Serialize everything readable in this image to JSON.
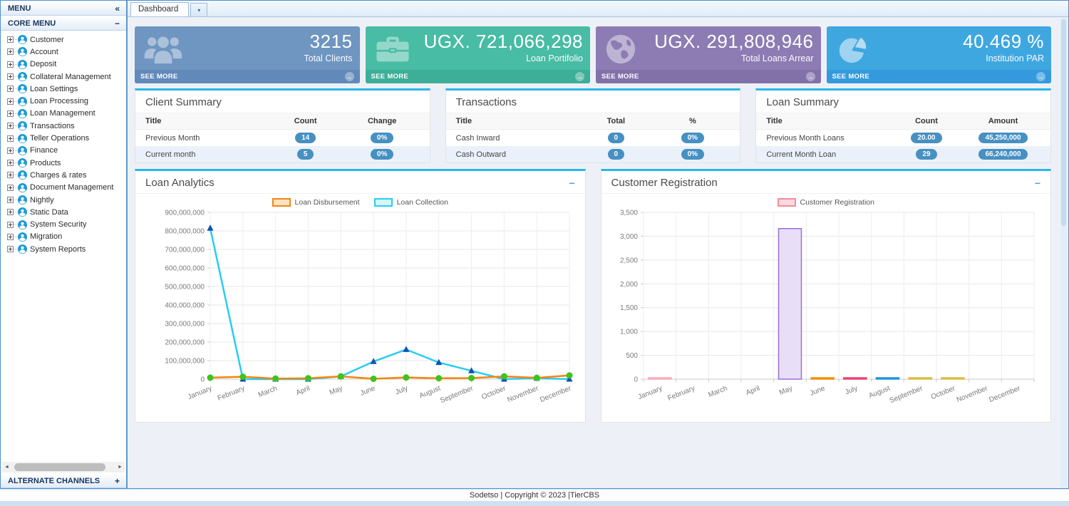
{
  "window": {
    "footer": "Sodetso | Copyright © 2023 |TierCBS"
  },
  "sidebar": {
    "menu_header": "MENU",
    "collapse_icon": "«",
    "core_menu": {
      "label": "CORE MENU",
      "state_icon": "−"
    },
    "items": [
      "Customer",
      "Account",
      "Deposit",
      "Collateral Management",
      "Loan Settings",
      "Loan Processing",
      "Loan Management",
      "Transactions",
      "Teller Operations",
      "Finance",
      "Products",
      "Charges & rates",
      "Document Management",
      "Nightly",
      "Static Data",
      "System Security",
      "Migration",
      "System Reports"
    ],
    "alternate": {
      "label": "ALTERNATE CHANNELS",
      "state_icon": "+"
    }
  },
  "tabbar": {
    "active_tab": "Dashboard"
  },
  "stat_cards": [
    {
      "name": "total-clients-card",
      "icon": "users-icon",
      "value": "3215",
      "label": "Total Clients",
      "see_more": "SEE MORE",
      "color": "#6f95c1",
      "strip_color": "#6189ba"
    },
    {
      "name": "loan-portfolio-card",
      "icon": "briefcase-icon",
      "value": "UGX. 721,066,298",
      "label": "Loan Portifolio",
      "see_more": "SEE MORE",
      "color": "#48bca4",
      "strip_color": "#3dae97"
    },
    {
      "name": "total-loans-arrear-card",
      "icon": "globe-icon",
      "value": "UGX. 291,808,946",
      "label": "Total Loans Arrear",
      "see_more": "SEE MORE",
      "color": "#8d7cb3",
      "strip_color": "#8271a9"
    },
    {
      "name": "institution-par-card",
      "icon": "pie-icon",
      "value": "40.469 %",
      "label": "Institution PAR",
      "see_more": "SEE MORE",
      "color": "#3fa7e0",
      "strip_color": "#359add"
    }
  ],
  "summary_panels": [
    {
      "name": "client-summary-panel",
      "title": "Client Summary",
      "columns": [
        "Title",
        "Count",
        "Change"
      ],
      "rows": [
        [
          "Previous Month",
          "14",
          "0%"
        ],
        [
          "Current month",
          "5",
          "0%"
        ]
      ]
    },
    {
      "name": "transactions-panel",
      "title": "Transactions",
      "columns": [
        "Title",
        "Total",
        "%"
      ],
      "rows": [
        [
          "Cash Inward",
          "0",
          "0%"
        ],
        [
          "Cash Outward",
          "0",
          "0%"
        ]
      ]
    },
    {
      "name": "loan-summary-panel",
      "title": "Loan Summary",
      "columns": [
        "Title",
        "Count",
        "Amount"
      ],
      "rows": [
        [
          "Previous Month Loans",
          "20.00",
          "45,250,000"
        ],
        [
          "Current Month Loan",
          "29",
          "66,240,000"
        ]
      ]
    }
  ],
  "accent_colors": {
    "panel_top_border": "#29b7e9",
    "badge": "#4690c2"
  },
  "chart_data": [
    {
      "type": "line",
      "title": "Loan Analytics",
      "categories": [
        "January",
        "February",
        "March",
        "April",
        "May",
        "June",
        "July",
        "August",
        "September",
        "October",
        "November",
        "December"
      ],
      "series": [
        {
          "name": "Loan Disbursement",
          "line_color": "#f58511",
          "legend_fill": "#fbe3c4",
          "marker": "circle",
          "marker_color": "#3fc31d",
          "values": [
            8000000,
            13000000,
            3000000,
            5000000,
            15000000,
            2000000,
            9000000,
            5000000,
            6000000,
            15000000,
            7000000,
            20000000
          ]
        },
        {
          "name": "Loan Collection",
          "line_color": "#27cdf2",
          "legend_fill": "#d6f6fd",
          "marker": "triangle",
          "marker_color": "#1350b0",
          "values": [
            815000000,
            0,
            0,
            0,
            15000000,
            95000000,
            160000000,
            90000000,
            45000000,
            0,
            5000000,
            0
          ]
        }
      ],
      "ylim": [
        0,
        900000000
      ],
      "ytick_step": 100000000,
      "grid": true,
      "legend_position": "top"
    },
    {
      "type": "bar",
      "title": "Customer Registration",
      "categories": [
        "January",
        "February",
        "March",
        "April",
        "May",
        "June",
        "July",
        "August",
        "September",
        "October",
        "November",
        "December"
      ],
      "values": [
        12,
        0,
        0,
        0,
        3160,
        15,
        22,
        20,
        6,
        6,
        0,
        0
      ],
      "bar_fills": [
        "#fbd3d8",
        "#fbd3d8",
        "#fbd3d8",
        "#fbd3d8",
        "#e9def8",
        "#f5a623",
        "#f2608c",
        "#3aa3e8",
        "#e8d06e",
        "#e8d06e",
        "#fbd3d8",
        "#fbd3d8"
      ],
      "bar_borders": [
        "#f5a5b0",
        "#f5a5b0",
        "#f5a5b0",
        "#f5a5b0",
        "#9b6fd6",
        "#ef8c00",
        "#ea3d6e",
        "#1f8fdd",
        "#d9b83a",
        "#d9b83a",
        "#f5a5b0",
        "#f5a5b0"
      ],
      "legend": {
        "label": "Customer Registration",
        "fill": "#fbd9de",
        "border": "#f28ba0"
      },
      "ylim": [
        0,
        3500
      ],
      "ytick_step": 500,
      "grid": true,
      "legend_position": "top"
    }
  ]
}
